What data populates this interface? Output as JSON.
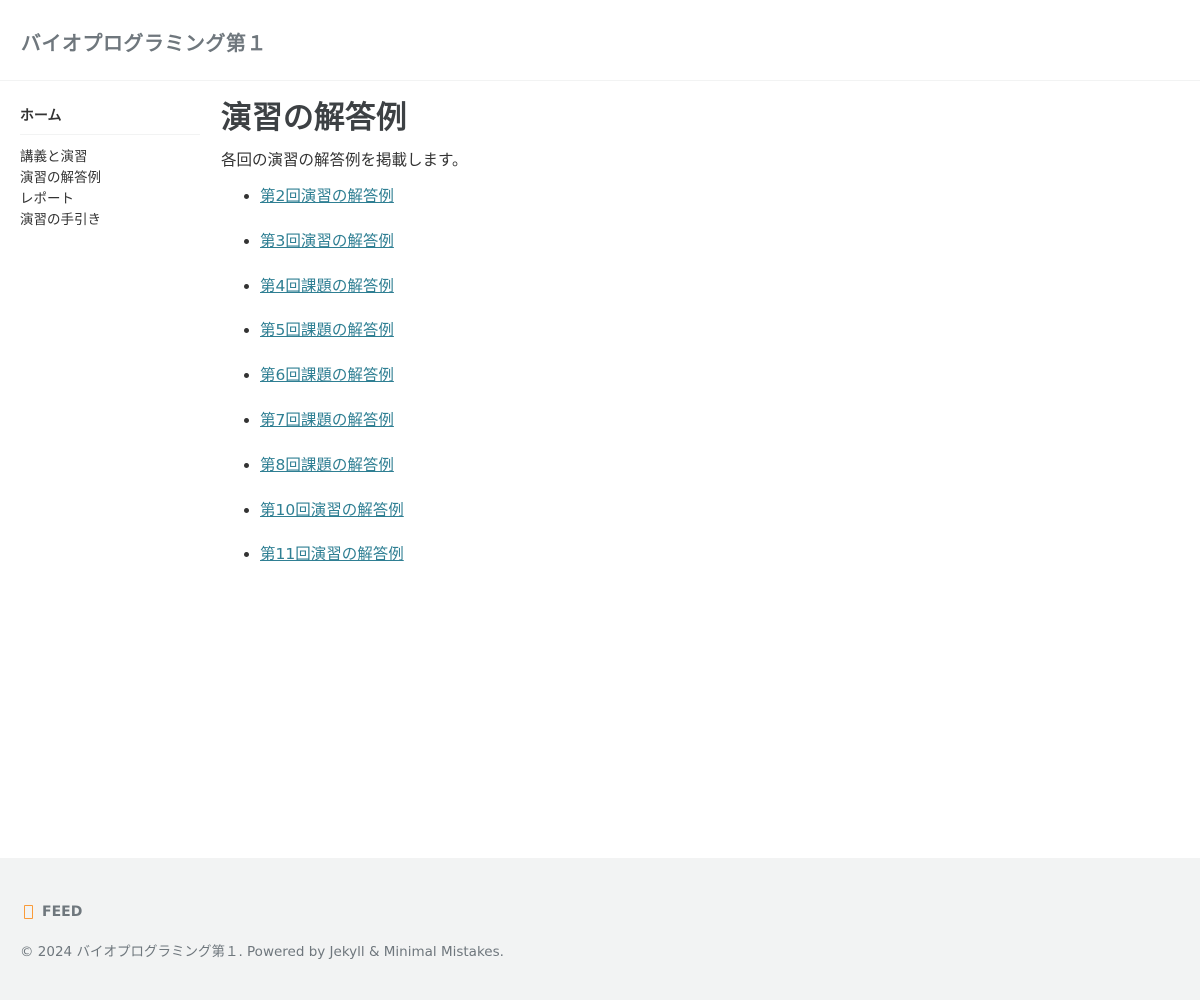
{
  "masthead": {
    "site_title": "バイオプログラミング第１"
  },
  "sidebar": {
    "title": "ホーム",
    "items": [
      {
        "label": "講義と演習"
      },
      {
        "label": "演習の解答例"
      },
      {
        "label": "レポート"
      },
      {
        "label": "演習の手引き"
      }
    ]
  },
  "main": {
    "title": "演習の解答例",
    "intro": "各回の演習の解答例を掲載します。",
    "links": [
      {
        "label": "第2回演習の解答例"
      },
      {
        "label": "第3回演習の解答例"
      },
      {
        "label": "第4回課題の解答例"
      },
      {
        "label": "第5回課題の解答例"
      },
      {
        "label": "第6回課題の解答例"
      },
      {
        "label": "第7回課題の解答例"
      },
      {
        "label": "第8回課題の解答例"
      },
      {
        "label": "第10回演習の解答例"
      },
      {
        "label": "第11回演習の解答例"
      }
    ]
  },
  "footer": {
    "feed_label": "FEED",
    "feed_icon": "rss-icon",
    "copyright": "© 2024 バイオプログラミング第１. Powered by Jekyll & Minimal Mistakes."
  },
  "colors": {
    "link": "#2f7f93",
    "footer_bg": "#f2f3f3",
    "feed_icon": "#fa9b39",
    "muted_text": "#6f777d"
  }
}
